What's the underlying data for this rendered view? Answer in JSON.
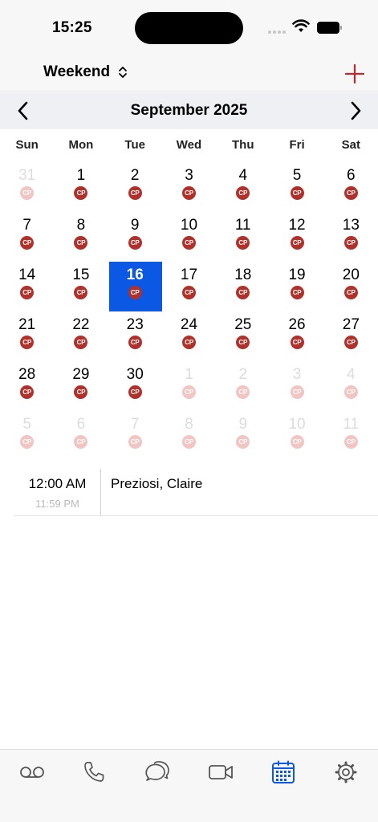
{
  "status_bar": {
    "time": "15:25"
  },
  "nav": {
    "view_label": "Weekend"
  },
  "month_header": {
    "title": "September 2025"
  },
  "weekdays": [
    "Sun",
    "Mon",
    "Tue",
    "Wed",
    "Thu",
    "Fri",
    "Sat"
  ],
  "badge_label": "CP",
  "calendar": {
    "selected_day": "16",
    "weeks": [
      [
        {
          "d": "31",
          "m": true
        },
        {
          "d": "1"
        },
        {
          "d": "2"
        },
        {
          "d": "3"
        },
        {
          "d": "4"
        },
        {
          "d": "5"
        },
        {
          "d": "6"
        }
      ],
      [
        {
          "d": "7"
        },
        {
          "d": "8"
        },
        {
          "d": "9"
        },
        {
          "d": "10"
        },
        {
          "d": "11"
        },
        {
          "d": "12"
        },
        {
          "d": "13"
        }
      ],
      [
        {
          "d": "14"
        },
        {
          "d": "15"
        },
        {
          "d": "16",
          "s": true
        },
        {
          "d": "17"
        },
        {
          "d": "18"
        },
        {
          "d": "19"
        },
        {
          "d": "20"
        }
      ],
      [
        {
          "d": "21"
        },
        {
          "d": "22"
        },
        {
          "d": "23"
        },
        {
          "d": "24"
        },
        {
          "d": "25"
        },
        {
          "d": "26"
        },
        {
          "d": "27"
        }
      ],
      [
        {
          "d": "28"
        },
        {
          "d": "29"
        },
        {
          "d": "30"
        },
        {
          "d": "1",
          "m": true
        },
        {
          "d": "2",
          "m": true
        },
        {
          "d": "3",
          "m": true
        },
        {
          "d": "4",
          "m": true
        }
      ],
      [
        {
          "d": "5",
          "m": true
        },
        {
          "d": "6",
          "m": true
        },
        {
          "d": "7",
          "m": true
        },
        {
          "d": "8",
          "m": true
        },
        {
          "d": "9",
          "m": true
        },
        {
          "d": "10",
          "m": true
        },
        {
          "d": "11",
          "m": true
        }
      ]
    ]
  },
  "events": [
    {
      "start": "12:00 AM",
      "end": "11:59 PM",
      "title": "Preziosi, Claire"
    }
  ],
  "tabs": [
    {
      "name": "voicemail-icon"
    },
    {
      "name": "phone-icon"
    },
    {
      "name": "chat-icon"
    },
    {
      "name": "video-icon"
    },
    {
      "name": "calendar-icon",
      "active": true
    },
    {
      "name": "settings-icon"
    }
  ],
  "colors": {
    "accent": "#0a58e4",
    "badge": "#b3302a",
    "add": "#c0282d"
  }
}
